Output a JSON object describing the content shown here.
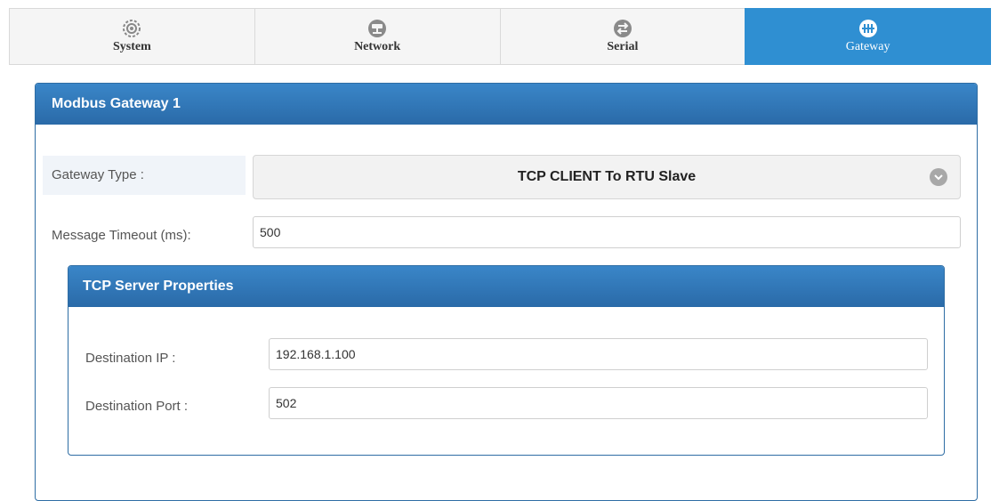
{
  "tabs": [
    {
      "label": "System",
      "icon": "gear-icon",
      "active": false
    },
    {
      "label": "Network",
      "icon": "network-icon",
      "active": false
    },
    {
      "label": "Serial",
      "icon": "swap-arrows-icon",
      "active": false
    },
    {
      "label": "Gateway",
      "icon": "gateway-icon",
      "active": true
    }
  ],
  "panel": {
    "title": "Modbus Gateway 1",
    "gateway_type_label": "Gateway Type :",
    "gateway_type_value": "TCP CLIENT To RTU Slave",
    "timeout_label": "Message Timeout (ms):",
    "timeout_value": "500"
  },
  "tcp_server": {
    "title": "TCP Server Properties",
    "ip_label": "Destination IP :",
    "ip_value": "192.168.1.100",
    "port_label": "Destination Port :",
    "port_value": "502"
  },
  "colors": {
    "accent": "#2f8fd2",
    "heading": "#2a6aa8"
  }
}
